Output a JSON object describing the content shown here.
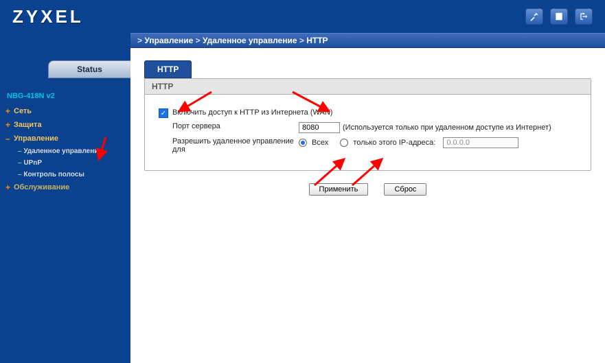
{
  "brand": "ZYXEL",
  "model": "NBG-418N v2",
  "status_tab": "Status",
  "nav": {
    "net": "Сеть",
    "security": "Защита",
    "management": "Управление",
    "sub": {
      "remote": "Удаленное управление",
      "upnp": "UPnP",
      "bandwidth": "Контроль полосы"
    },
    "maintenance": "Обслуживание"
  },
  "breadcrumb": {
    "a": "Управление",
    "b": "Удаленное управление",
    "c": "HTTP"
  },
  "tab_http": "HTTP",
  "panel_title": "HTTP",
  "form": {
    "enable_label": "Включить доступ к HTTP из Интернета (WAN)",
    "server_port_label": "Порт сервера",
    "server_port_value": "8080",
    "server_port_note": "(Используется только при удаленном доступе из Интернет)",
    "allow_label_line1": "Разрешить удаленное управление",
    "allow_label_line2": "для",
    "radio_all": "Всех",
    "radio_only_ip": "только этого IP-адреса:",
    "ip_value": "0.0.0.0"
  },
  "buttons": {
    "apply": "Применить",
    "reset": "Сброс"
  }
}
